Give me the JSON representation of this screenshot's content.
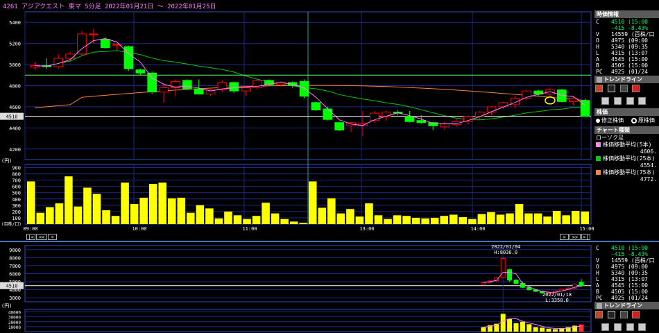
{
  "window": {
    "title": "4261 アジアクエスト 東マ 5分足 2022年01月21日 ～ 2022年01月25日"
  },
  "price_axis": {
    "ticks": [
      "5400",
      "5200",
      "5000",
      "4800",
      "4600",
      "4400",
      "4200"
    ],
    "current": "4510"
  },
  "volume_axis": {
    "unit": "(円)",
    "ticks": [
      "900",
      "800",
      "700",
      "600",
      "500",
      "400",
      "300",
      "200",
      "100"
    ],
    "unit_bottom": "(百株/口)"
  },
  "time_axis": {
    "ticks": [
      "09:00",
      "10:00",
      "11:00",
      "13:00",
      "14:00",
      "15:00"
    ]
  },
  "nav": {
    "first": "|<",
    "prev_fast": "<<",
    "prev": "<",
    "next": ">",
    "next_fast": ">>",
    "last": ">|"
  },
  "colors": {
    "up": "#ff0000",
    "down": "#00ff00",
    "volume": "#ffff00",
    "ma5": "#ff80ff",
    "ma25": "#00cc00",
    "ma75": "#ff8040",
    "grid": "#1a2a8a",
    "line_4900": "#66ff66",
    "line_4510": "#ffffff"
  },
  "side": {
    "quote_header": "時価情報",
    "quote": [
      {
        "k": "C",
        "v": "4510 (15:00"
      },
      {
        "k": "",
        "v": "-415 -8.43%"
      },
      {
        "k": "V",
        "v": "14559 (百株/口"
      },
      {
        "k": "O",
        "v": "4975 (09:00"
      },
      {
        "k": "H",
        "v": "5340 (09:35"
      },
      {
        "k": "L",
        "v": "4315 (13:07"
      },
      {
        "k": "A",
        "v": "4545 (15:00"
      },
      {
        "k": "B",
        "v": "4505 (15:00"
      },
      {
        "k": "PC",
        "v": "4925 (01/24"
      }
    ],
    "trendline_label": "トレンドライン",
    "kabuka_header": "株価",
    "radio1": "修正株価",
    "radio2": "原株価",
    "chart_type_header": "チャート種類",
    "chart_type": "ローソク足",
    "ma": [
      {
        "label": "株価移動平均(5本)",
        "value": "4606."
      },
      {
        "label": "株価移動平均(25本)",
        "value": "4554."
      },
      {
        "label": "株価移動平均(75本)",
        "value": "4772."
      }
    ]
  },
  "lower": {
    "price_ticks": [
      "9000",
      "8000",
      "7000",
      "6000",
      "5000",
      "4000",
      "3000"
    ],
    "current": "4510",
    "high_label_date": "2022/01/04",
    "high_label_value": "H:8030.0",
    "low_label_date": "2022/01/18",
    "low_label_value": "L:3350.0",
    "vol_unit": "(円)",
    "vol_ticks": [
      "40000",
      "30000",
      "20000",
      "10000"
    ],
    "quote": [
      {
        "k": "C",
        "v": "4510 (15:00"
      },
      {
        "k": "",
        "v": "-415 -8.43%"
      },
      {
        "k": "V",
        "v": "14559 (百株/口"
      },
      {
        "k": "O",
        "v": "4975 (09:00"
      },
      {
        "k": "H",
        "v": "5340 (09:35"
      },
      {
        "k": "L",
        "v": "4315 (13:07"
      },
      {
        "k": "A",
        "v": "4545 (15:00"
      },
      {
        "k": "B",
        "v": "4505 (15:00"
      },
      {
        "k": "PC",
        "v": "4925 (01/24"
      }
    ],
    "trendline_label": "トレンドライン"
  },
  "chart_data": [
    {
      "type": "candlestick",
      "title": "4261 アジアクエスト 東マ 5分足 2022年01月21日 ～ 2022年01月25日",
      "ylim": [
        4100,
        5500
      ],
      "x": [
        "09:00",
        "",
        "",
        "",
        "",
        "",
        "10:00",
        "",
        "",
        "",
        "",
        "",
        "",
        "11:00",
        "",
        "",
        "",
        "",
        "",
        "",
        "",
        "",
        "13:00",
        "",
        "",
        "",
        "",
        "",
        "14:00",
        "",
        "",
        "",
        "",
        "",
        "",
        "15:00"
      ],
      "candles": [
        [
          4975,
          5020,
          4950,
          4990
        ],
        [
          4990,
          5060,
          4960,
          4980
        ],
        [
          4980,
          5100,
          4960,
          5060
        ],
        [
          5060,
          5120,
          5030,
          5100
        ],
        [
          5100,
          5320,
          5090,
          5290
        ],
        [
          5290,
          5340,
          5200,
          5290
        ],
        [
          5240,
          5260,
          5150,
          5160
        ],
        [
          5190,
          5200,
          5140,
          5190
        ],
        [
          5170,
          5180,
          4940,
          4960
        ],
        [
          4950,
          4960,
          4900,
          4920
        ],
        [
          4920,
          4930,
          4720,
          4740
        ],
        [
          4740,
          4820,
          4640,
          4780
        ],
        [
          4780,
          4860,
          4700,
          4840
        ],
        [
          4850,
          4860,
          4760,
          4770
        ],
        [
          4770,
          4860,
          4720,
          4720
        ],
        [
          4720,
          4780,
          4700,
          4760
        ],
        [
          4760,
          4850,
          4740,
          4830
        ],
        [
          4830,
          4840,
          4730,
          4750
        ],
        [
          4750,
          4800,
          4700,
          4780
        ],
        [
          4780,
          4860,
          4760,
          4850
        ],
        [
          4850,
          4860,
          4800,
          4810
        ],
        [
          4810,
          4840,
          4790,
          4830
        ],
        [
          4830,
          4840,
          4780,
          4800
        ],
        [
          4840,
          4860,
          4680,
          4700
        ],
        [
          4640,
          4650,
          4560,
          4570
        ],
        [
          4580,
          4600,
          4470,
          4480
        ],
        [
          4450,
          4460,
          4370,
          4380
        ],
        [
          4420,
          4460,
          4360,
          4450
        ],
        [
          4420,
          4560,
          4320,
          4440
        ],
        [
          4470,
          4560,
          4450,
          4540
        ],
        [
          4510,
          4560,
          4470,
          4550
        ],
        [
          4550,
          4570,
          4520,
          4540
        ],
        [
          4510,
          4560,
          4450,
          4460
        ],
        [
          4470,
          4520,
          4440,
          4450
        ],
        [
          4450,
          4460,
          4380,
          4420
        ],
        [
          4410,
          4460,
          4380,
          4440
        ],
        [
          4430,
          4480,
          4410,
          4460
        ],
        [
          4460,
          4520,
          4430,
          4510
        ],
        [
          4510,
          4560,
          4480,
          4550
        ],
        [
          4550,
          4610,
          4520,
          4600
        ],
        [
          4600,
          4650,
          4580,
          4640
        ],
        [
          4620,
          4700,
          4590,
          4680
        ],
        [
          4680,
          4760,
          4660,
          4750
        ],
        [
          4750,
          4760,
          4700,
          4720
        ],
        [
          4720,
          4780,
          4700,
          4760
        ],
        [
          4760,
          4770,
          4640,
          4650
        ],
        [
          4650,
          4700,
          4610,
          4680
        ],
        [
          4660,
          4680,
          4520,
          4510
        ]
      ],
      "volume": [
        680,
        180,
        270,
        330,
        760,
        280,
        580,
        480,
        220,
        130,
        660,
        320,
        420,
        640,
        660,
        410,
        420,
        180,
        300,
        250,
        90,
        200,
        140,
        80,
        130,
        340,
        170,
        80,
        40,
        20,
        680,
        260,
        410,
        170,
        240,
        120,
        330,
        140,
        80,
        140,
        130,
        100,
        90,
        100,
        130,
        150,
        110,
        80,
        160,
        190,
        150,
        170,
        320,
        170,
        170,
        120,
        210,
        140,
        210,
        200
      ],
      "ma_series": [
        "株価移動平均(5本)",
        "株価移動平均(25本)",
        "株価移動平均(75本)"
      ],
      "hlines": [
        4900,
        4510
      ]
    },
    {
      "type": "candlestick",
      "annotations": [
        "2022/01/04 H:8030.0",
        "2022/01/18 L:3350.0"
      ],
      "ylim": [
        2500,
        9500
      ],
      "candles": [
        [
          4700,
          5000,
          4600,
          4900
        ],
        [
          4900,
          5200,
          4800,
          5100
        ],
        [
          5100,
          5600,
          5000,
          5500
        ],
        [
          5500,
          8030,
          5400,
          7900
        ],
        [
          6500,
          6600,
          5000,
          5200
        ],
        [
          5200,
          5300,
          4700,
          4800
        ],
        [
          4800,
          5000,
          4200,
          4300
        ],
        [
          4300,
          4400,
          3900,
          4000
        ],
        [
          4000,
          4100,
          3700,
          3800
        ],
        [
          3800,
          3900,
          3500,
          3600
        ],
        [
          3600,
          3700,
          3350,
          3650
        ],
        [
          3650,
          3900,
          3600,
          3850
        ],
        [
          3850,
          4100,
          3800,
          4050
        ],
        [
          4050,
          4300,
          4000,
          4200
        ],
        [
          4200,
          4800,
          4100,
          4700
        ],
        [
          4925,
          5340,
          4315,
          4510
        ]
      ],
      "volume": [
        9000,
        13000,
        16000,
        36000,
        26000,
        17000,
        20000,
        15000,
        9000,
        8000,
        6000,
        5000,
        7000,
        9000,
        12000,
        14559
      ]
    }
  ]
}
